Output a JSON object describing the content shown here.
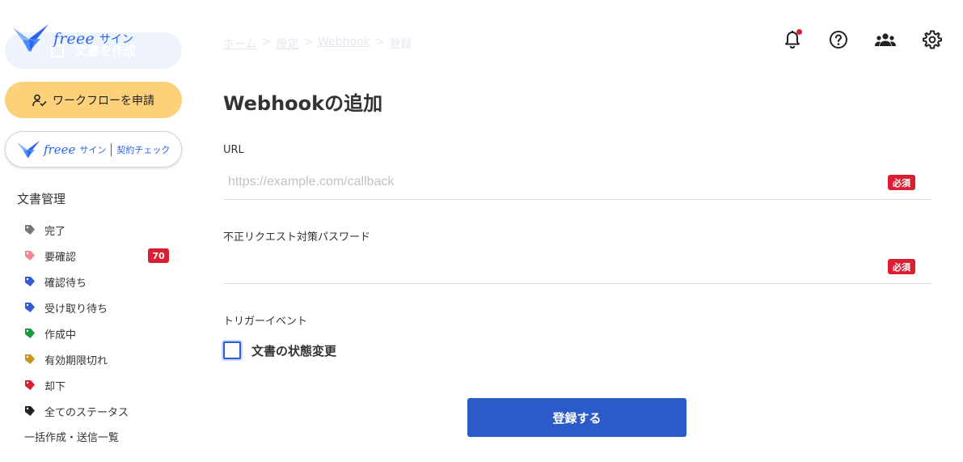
{
  "brand": {
    "name": "freee",
    "product": "サイン"
  },
  "sidebar": {
    "create_button_label": "文書を作成",
    "workflow_button_label": "ワークフローを申請",
    "check_button": {
      "name": "freee",
      "product": "サイン",
      "feature": "契約チェック"
    },
    "section_title": "文書管理",
    "statuses": [
      {
        "label": "完了",
        "color": "#777777"
      },
      {
        "label": "要確認",
        "color": "#f08a96",
        "badge": "70"
      },
      {
        "label": "確認待ち",
        "color": "#2f5bd0"
      },
      {
        "label": "受け取り待ち",
        "color": "#2f5bd0"
      },
      {
        "label": "作成中",
        "color": "#1a9a3c"
      },
      {
        "label": "有効期限切れ",
        "color": "#c8961e"
      },
      {
        "label": "却下",
        "color": "#dc1e32"
      },
      {
        "label": "全てのステータス",
        "color": "#222222"
      }
    ],
    "bulk_link_label": "一括作成・送信一覧"
  },
  "breadcrumb": {
    "items": [
      "ホーム",
      "設定",
      "Webhook",
      "登録"
    ],
    "separator": ">"
  },
  "header_icons": [
    "bell-icon",
    "help-icon",
    "team-icon",
    "gear-icon"
  ],
  "main": {
    "title": "Webhookの追加",
    "url_field": {
      "label": "URL",
      "value": "",
      "placeholder": "https://example.com/callback",
      "required_badge": "必須"
    },
    "password_field": {
      "label": "不正リクエスト対策パスワード",
      "value": "",
      "placeholder": "",
      "required_badge": "必須"
    },
    "trigger": {
      "label": "トリガーイベント",
      "option_label": "文書の状態変更",
      "checked": false
    },
    "submit_label": "登録する"
  },
  "colors": {
    "brand_blue": "#2864f0",
    "primary_button": "#2b5bc8",
    "workflow_button": "#fdd07a",
    "required_red": "#dc1e32"
  }
}
